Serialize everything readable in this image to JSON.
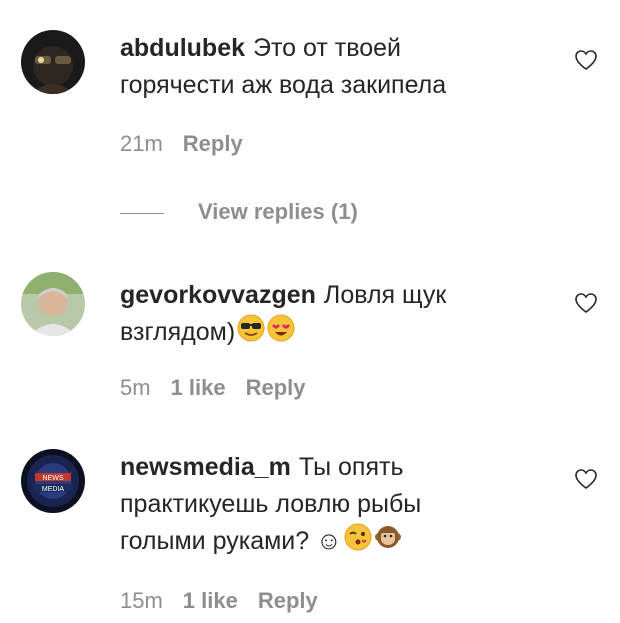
{
  "comments": [
    {
      "username": "abdulubek",
      "text": "Это от твоей горячести аж вода закипела",
      "time": "21m",
      "likes": "",
      "reply_label": "Reply",
      "view_replies": "View replies (1)"
    },
    {
      "username": "gevorkovvazgen",
      "text": "Ловля щук взглядом)",
      "emojis": [
        "sunglasses-face-emoji",
        "heart-eyes-emoji"
      ],
      "time": "5m",
      "likes": "1 like",
      "reply_label": "Reply"
    },
    {
      "username": "newsmedia_m",
      "text": "Ты опять практикуешь ловлю рыбы голыми руками? ☺",
      "emojis": [
        "kissing-wink-emoji",
        "monkey-emoji"
      ],
      "time": "15m",
      "likes": "1 like",
      "reply_label": "Reply"
    }
  ],
  "colors": {
    "text": "#262626",
    "muted": "#8e8e8e",
    "background": "#ffffff"
  },
  "icons": {
    "like": "heart-outline-icon"
  }
}
